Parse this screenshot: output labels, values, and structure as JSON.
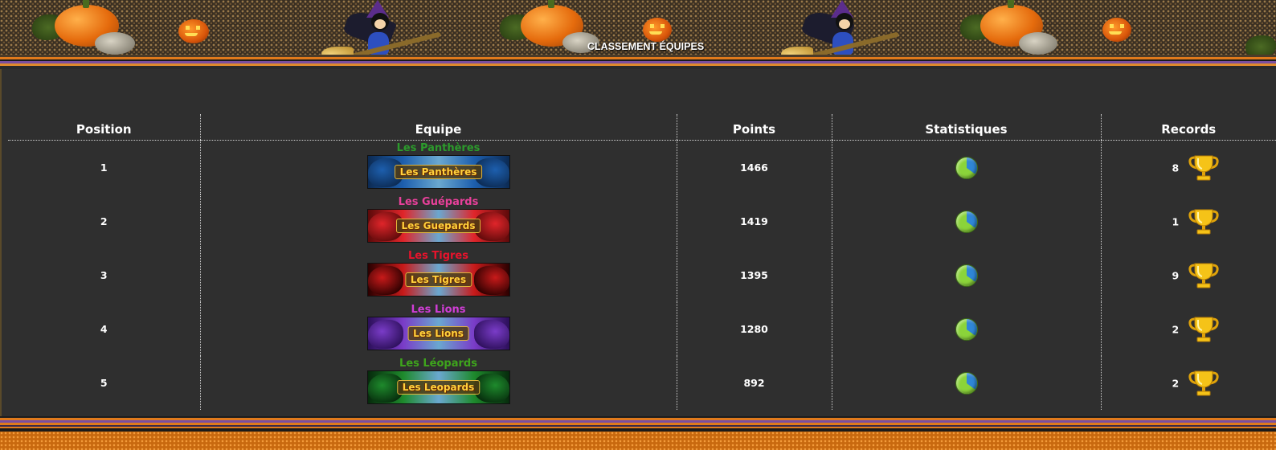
{
  "header": {
    "title": "CLASSEMENT ÉQUIPES"
  },
  "table": {
    "columns": {
      "position": "Position",
      "team": "Equipe",
      "points": "Points",
      "stats": "Statistiques",
      "records": "Records"
    },
    "rows": [
      {
        "position": "1",
        "team_name": "Les Panthères",
        "banner_text": "Les Panthères",
        "team_color": "#2c9b2c",
        "banner_colors": [
          "#1d5fae",
          "#0c2a52"
        ],
        "points": "1466",
        "records": "8",
        "stats_icon": "pie-chart-icon",
        "record_icon": "trophy-icon"
      },
      {
        "position": "2",
        "team_name": "Les Guépards",
        "banner_text": "Les Guepards",
        "team_color": "#e8409a",
        "banner_colors": [
          "#e0252a",
          "#5c0a0a"
        ],
        "points": "1419",
        "records": "1",
        "stats_icon": "pie-chart-icon",
        "record_icon": "trophy-icon"
      },
      {
        "position": "3",
        "team_name": "Les Tigres",
        "banner_text": "Les Tigres",
        "team_color": "#e8132c",
        "banner_colors": [
          "#c81a1a",
          "#2a0000"
        ],
        "points": "1395",
        "records": "9",
        "stats_icon": "pie-chart-icon",
        "record_icon": "trophy-icon"
      },
      {
        "position": "4",
        "team_name": "Les Lions",
        "banner_text": "Les Lions",
        "team_color": "#d03ed6",
        "banner_colors": [
          "#7a3cc8",
          "#2c0f5a"
        ],
        "points": "1280",
        "records": "2",
        "stats_icon": "pie-chart-icon",
        "record_icon": "trophy-icon"
      },
      {
        "position": "5",
        "team_name": "Les Léopards",
        "banner_text": "Les Leopards",
        "team_color": "#3ea51c",
        "banner_colors": [
          "#1e8a2c",
          "#062a0c"
        ],
        "points": "892",
        "records": "2",
        "stats_icon": "pie-chart-icon",
        "record_icon": "trophy-icon"
      }
    ]
  },
  "colors": {
    "background": "#2f2f2f",
    "accent_orange": "#e07a1c",
    "accent_purple": "#7a4fa0",
    "trophy_gold": "#f5c318"
  }
}
